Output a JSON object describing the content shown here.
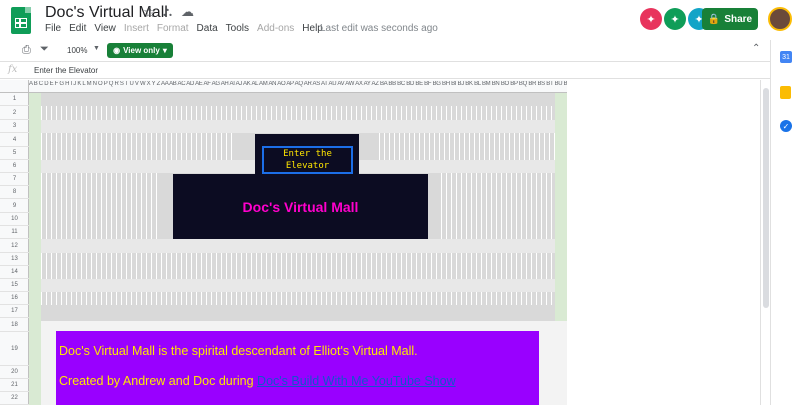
{
  "header": {
    "doc_title": "Doc's Virtual Mall",
    "menu": [
      "File",
      "Edit",
      "View",
      "Insert",
      "Format",
      "Data",
      "Tools",
      "Add-ons",
      "Help"
    ],
    "menu_dimmed": [
      "Insert",
      "Format",
      "Add-ons"
    ],
    "last_edit": "Last edit was seconds ago",
    "share_label": "Share",
    "collaborator_colors": [
      "#e8345d",
      "#0f9d58",
      "#12a4c7"
    ]
  },
  "toolbar": {
    "zoom": "100%",
    "view_mode": "View only"
  },
  "formula_bar": {
    "fx_label": "fx",
    "value": "Enter the Elevator"
  },
  "grid": {
    "column_letters": "A B C D E F G H I J K L M N O P Q R S T U V W X Y Z AA AB AC AD AE AF AG AH AI AJ AK AL AM AN AO AP AQ AR AS AT AU AV AW AX AY AZ BA BB BC BD BE BF BG BH BI BJ BK BL BM BN BO BP BQ BR BS BT BU BV BW BX BY BZ",
    "row_numbers": [
      "1",
      "2",
      "3",
      "4",
      "5",
      "6",
      "7",
      "8",
      "9",
      "10",
      "11",
      "12",
      "13",
      "14",
      "15",
      "16",
      "17",
      "18",
      "19",
      "20",
      "21",
      "22"
    ]
  },
  "sheet": {
    "elevator_label": "Enter the Elevator",
    "mall_title": "Doc's Virtual Mall",
    "info_line1": "Doc's Virtual Mall is the spirital descendant of Elliot's Virtual Mall.",
    "info_line2_prefix": "Created by Andrew and Doc during ",
    "info_line2_link": "Doc's Build With Me YouTube Show",
    "colors": {
      "elevator_text": "#ffe600",
      "mall_title": "#ff00cc",
      "info_bg": "#9900ff",
      "info_text": "#ffe600",
      "dark_panel": "#0c0c22"
    }
  }
}
